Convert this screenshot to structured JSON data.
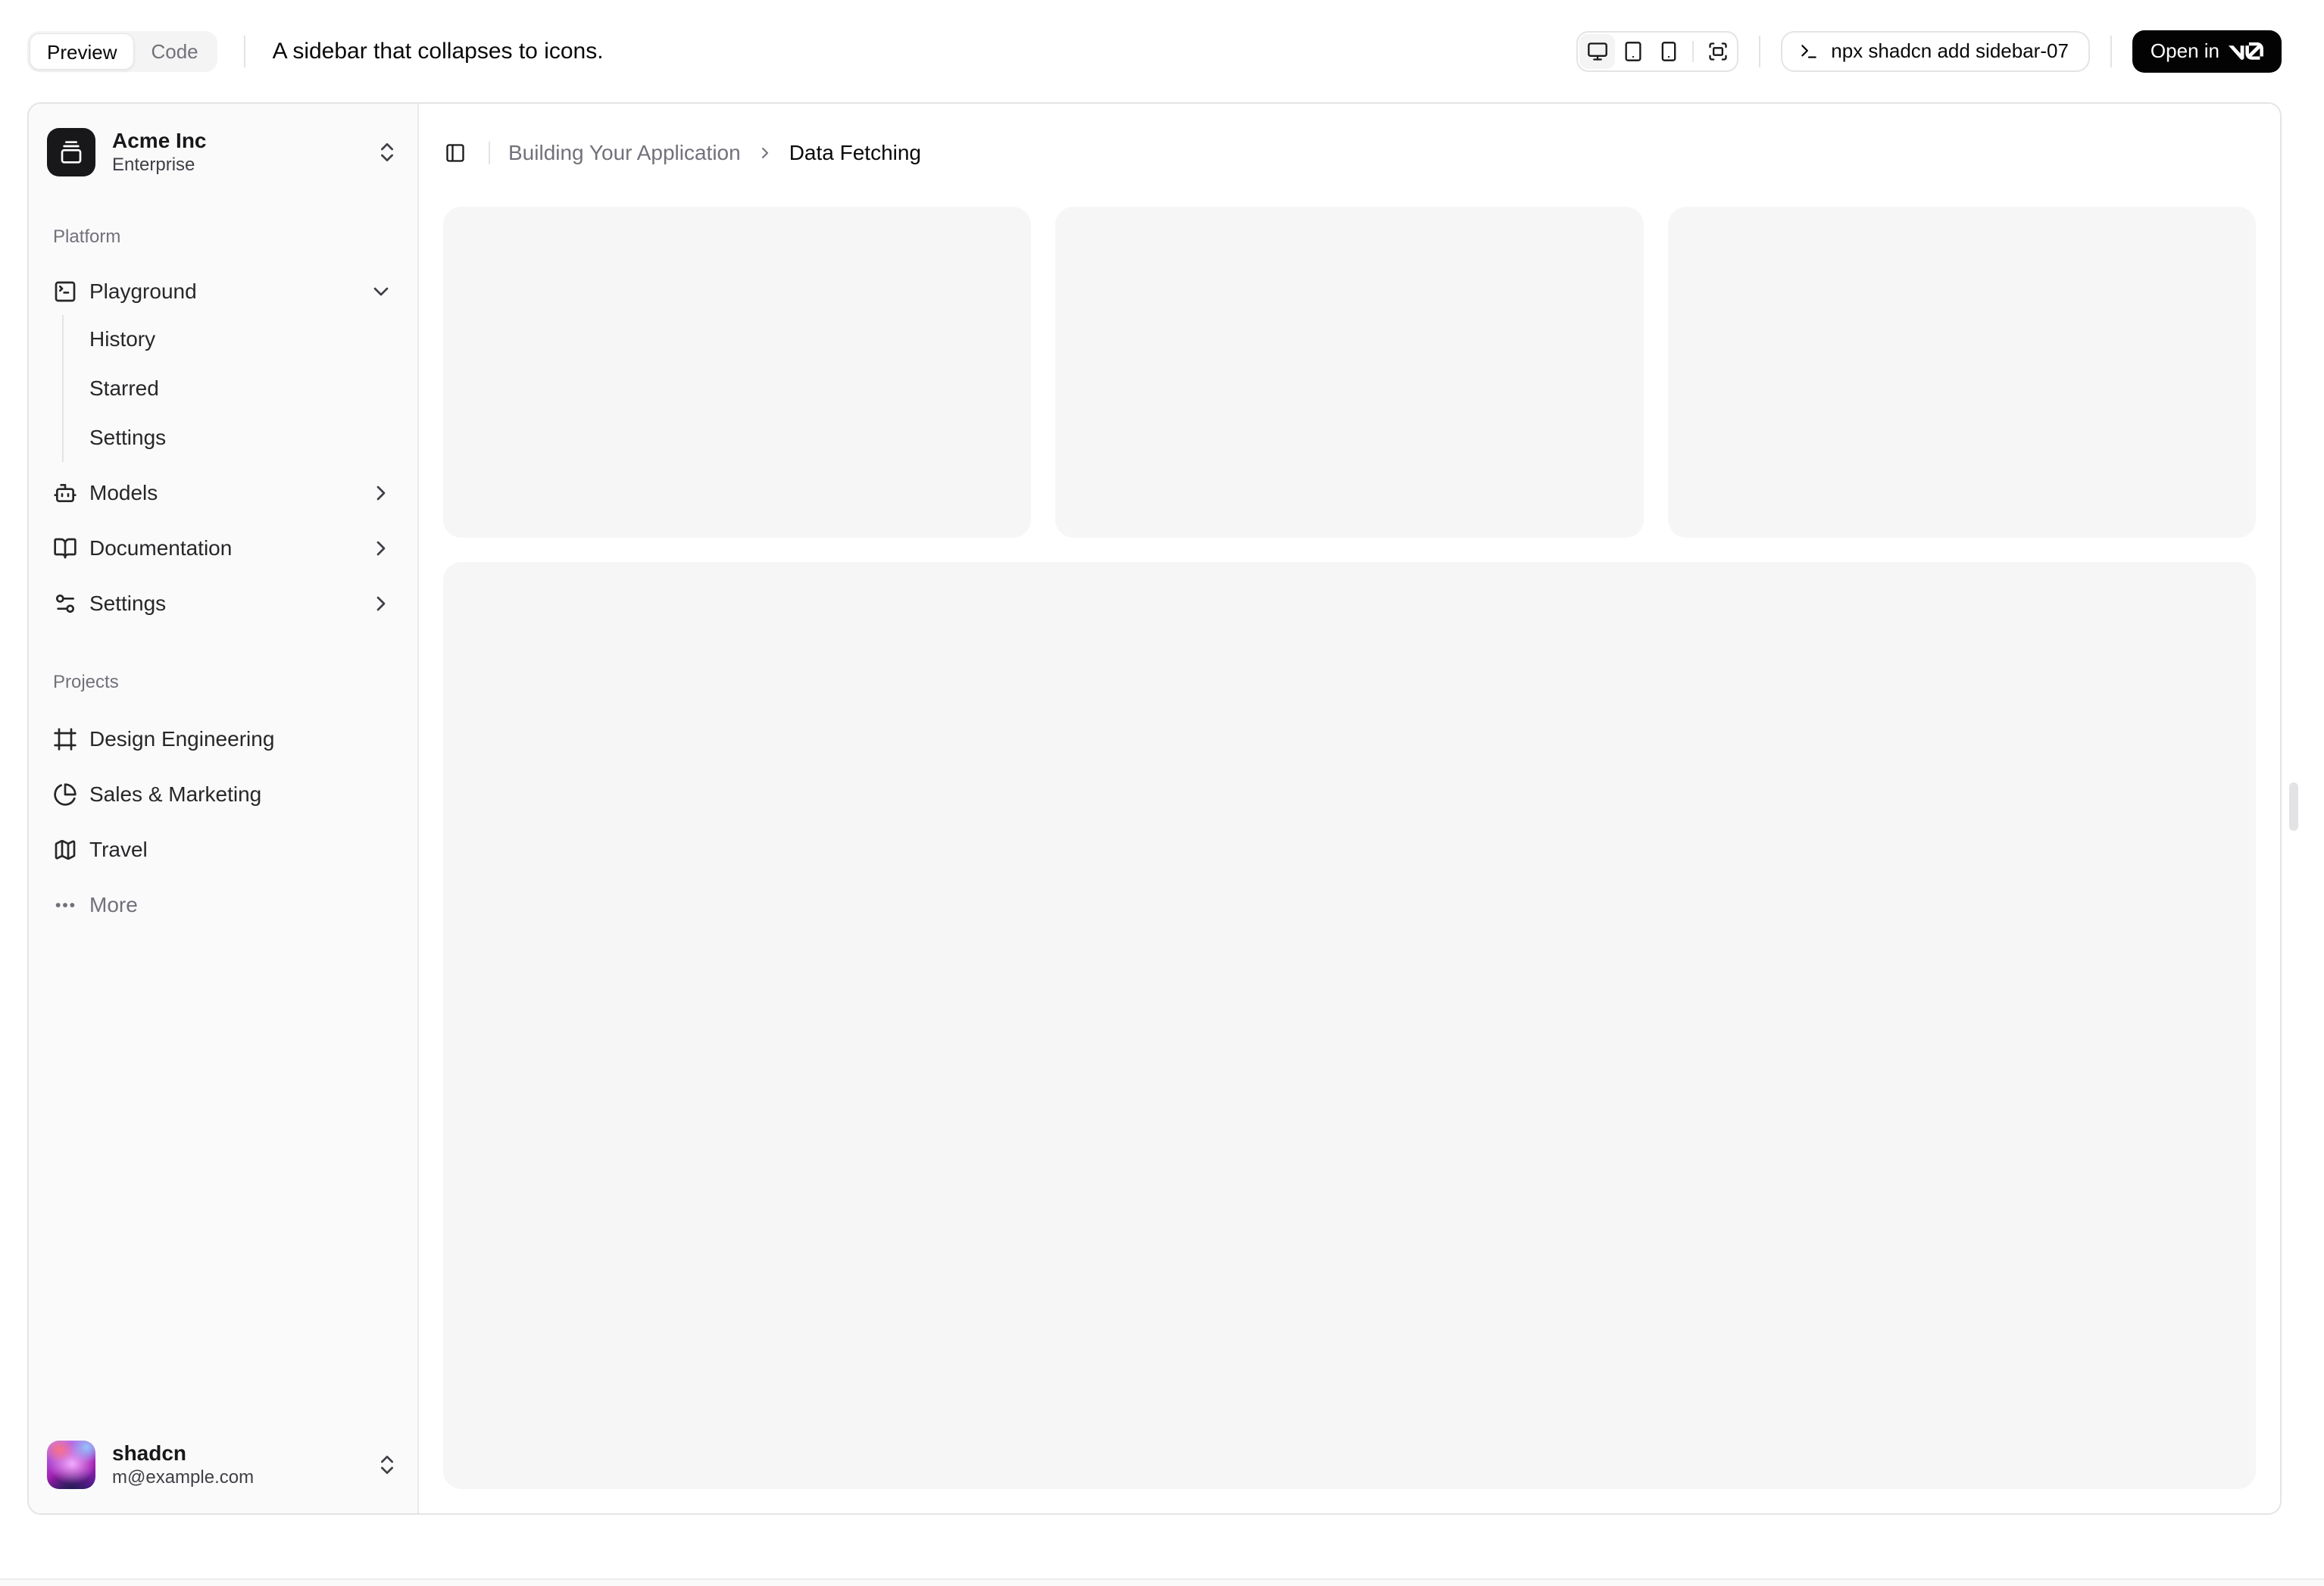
{
  "toolbar": {
    "tabs": [
      {
        "label": "Preview",
        "active": true
      },
      {
        "label": "Code",
        "active": false
      }
    ],
    "description": "A sidebar that collapses to icons.",
    "device_toggles": [
      "desktop",
      "tablet",
      "mobile",
      "fullscreen"
    ],
    "command": "npx shadcn add sidebar-07",
    "command_icon": "terminal-prompt-icon",
    "open_in_label": "Open in",
    "open_in_brand": "v0"
  },
  "breadcrumb": {
    "parent": "Building Your Application",
    "current": "Data Fetching"
  },
  "sidebar": {
    "team": {
      "name": "Acme Inc",
      "plan": "Enterprise",
      "logo_icon": "gallery-vertical-end"
    },
    "groups": [
      {
        "label": "Platform",
        "items": [
          {
            "label": "Playground",
            "icon": "square-terminal",
            "expanded": true,
            "children": [
              {
                "label": "History"
              },
              {
                "label": "Starred"
              },
              {
                "label": "Settings"
              }
            ]
          },
          {
            "label": "Models",
            "icon": "bot"
          },
          {
            "label": "Documentation",
            "icon": "book-open"
          },
          {
            "label": "Settings",
            "icon": "settings-sliders"
          }
        ]
      },
      {
        "label": "Projects",
        "items": [
          {
            "label": "Design Engineering",
            "icon": "frame"
          },
          {
            "label": "Sales & Marketing",
            "icon": "pie-chart"
          },
          {
            "label": "Travel",
            "icon": "map"
          },
          {
            "label": "More",
            "icon": "ellipsis",
            "muted": true
          }
        ]
      }
    ],
    "user": {
      "name": "shadcn",
      "email": "m@example.com"
    }
  },
  "colors": {
    "sidebar_bg": "#fafafa",
    "border": "#e4e4e7",
    "muted_text": "#71717a",
    "primary": "#18181b",
    "placeholder_card": "#f6f6f7"
  }
}
